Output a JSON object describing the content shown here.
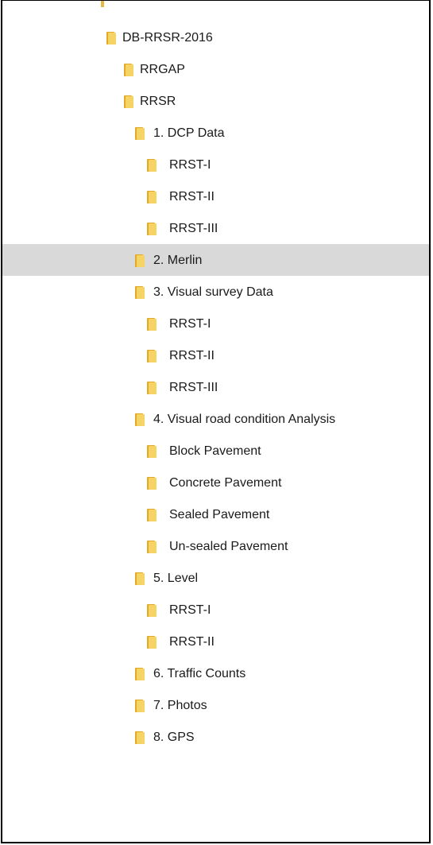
{
  "tree": {
    "items": [
      {
        "label": "DB-RRSR-2016",
        "depth": 0,
        "icon": "folder-icon"
      },
      {
        "label": "RRGAP",
        "depth": 1,
        "icon": "folder-icon"
      },
      {
        "label": "RRSR",
        "depth": 1,
        "icon": "folder-icon"
      },
      {
        "label": "1. DCP Data",
        "depth": 2,
        "icon": "folder-icon"
      },
      {
        "label": "RRST-I",
        "depth": 3,
        "icon": "folder-icon"
      },
      {
        "label": "RRST-II",
        "depth": 3,
        "icon": "folder-icon"
      },
      {
        "label": "RRST-III",
        "depth": 3,
        "icon": "folder-icon"
      },
      {
        "label": "2. Merlin",
        "depth": 2,
        "icon": "folder-icon",
        "selected": true
      },
      {
        "label": "3. Visual survey Data",
        "depth": 2,
        "icon": "folder-icon"
      },
      {
        "label": "RRST-I",
        "depth": 3,
        "icon": "folder-icon"
      },
      {
        "label": "RRST-II",
        "depth": 3,
        "icon": "folder-icon"
      },
      {
        "label": "RRST-III",
        "depth": 3,
        "icon": "folder-icon"
      },
      {
        "label": "4. Visual road condition Analysis",
        "depth": 2,
        "icon": "folder-icon"
      },
      {
        "label": "Block Pavement",
        "depth": 3,
        "icon": "folder-icon"
      },
      {
        "label": "Concrete Pavement",
        "depth": 3,
        "icon": "folder-icon"
      },
      {
        "label": "Sealed Pavement",
        "depth": 3,
        "icon": "folder-icon"
      },
      {
        "label": "Un-sealed Pavement",
        "depth": 3,
        "icon": "folder-icon"
      },
      {
        "label": "5. Level",
        "depth": 2,
        "icon": "folder-icon"
      },
      {
        "label": "RRST-I",
        "depth": 3,
        "icon": "folder-icon"
      },
      {
        "label": "RRST-II",
        "depth": 3,
        "icon": "folder-icon"
      },
      {
        "label": "6. Traffic Counts",
        "depth": 2,
        "icon": "folder-icon"
      },
      {
        "label": "7. Photos",
        "depth": 2,
        "icon": "folder-icon"
      },
      {
        "label": "8. GPS",
        "depth": 2,
        "icon": "folder-icon"
      }
    ]
  },
  "colors": {
    "folder_front": "#f6d365",
    "folder_back": "#e2a925",
    "selected_row": "#d9d9d9"
  }
}
